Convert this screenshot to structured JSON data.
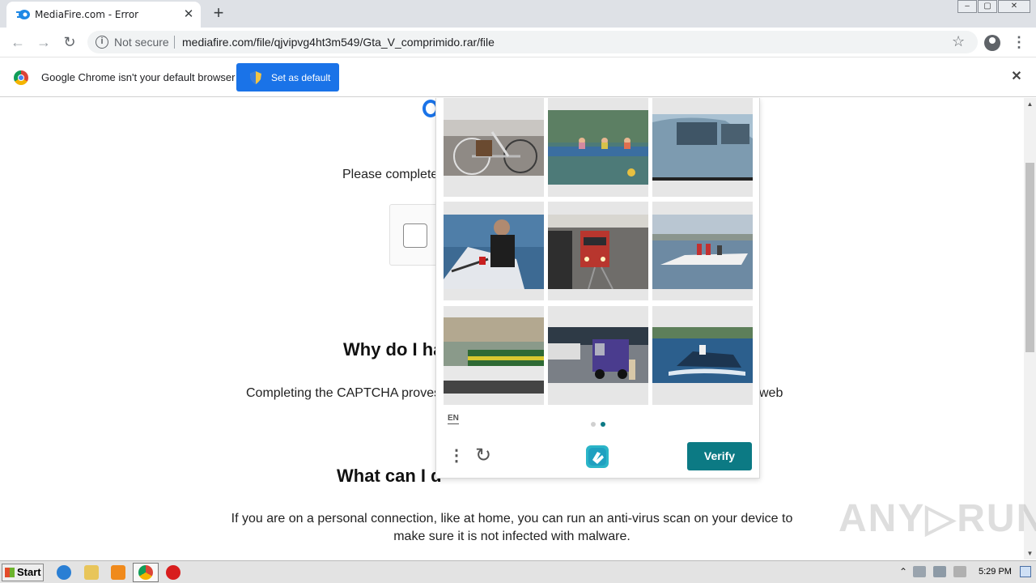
{
  "browser": {
    "tab_title": "MediaFire.com - Error",
    "new_tab_label": "+",
    "close_tab_label": "✕",
    "security_label": "Not secure",
    "url": "mediafire.com/file/qjvipvg4ht3m549/Gta_V_comprimido.rar/file"
  },
  "infobar": {
    "message": "Google Chrome isn't your default browser",
    "set_default_label": "Set as default",
    "close_label": "✕"
  },
  "page": {
    "please_complete": "Please complete",
    "why_heading": "Why do I ha",
    "completing_left": "Completing the CAPTCHA proves",
    "completing_right": "web",
    "what_heading": "What can I d",
    "advice_line1": "If you are on a personal connection, like at home, you can run an anti-virus scan on your device to",
    "advice_line2": "make sure it is not infected with malware."
  },
  "captcha": {
    "language": "EN",
    "verify_label": "Verify",
    "tiles": [
      "bicycle",
      "boat",
      "car",
      "boat",
      "train",
      "boat",
      "bus",
      "truck",
      "boat"
    ]
  },
  "watermark": "ANY▷RUN",
  "taskbar": {
    "start_label": "Start",
    "clock": "5:29 PM"
  },
  "colors": {
    "accent_blue": "#1a73e8",
    "verify_teal": "#0c7a84",
    "tab_strip": "#dee1e6"
  }
}
